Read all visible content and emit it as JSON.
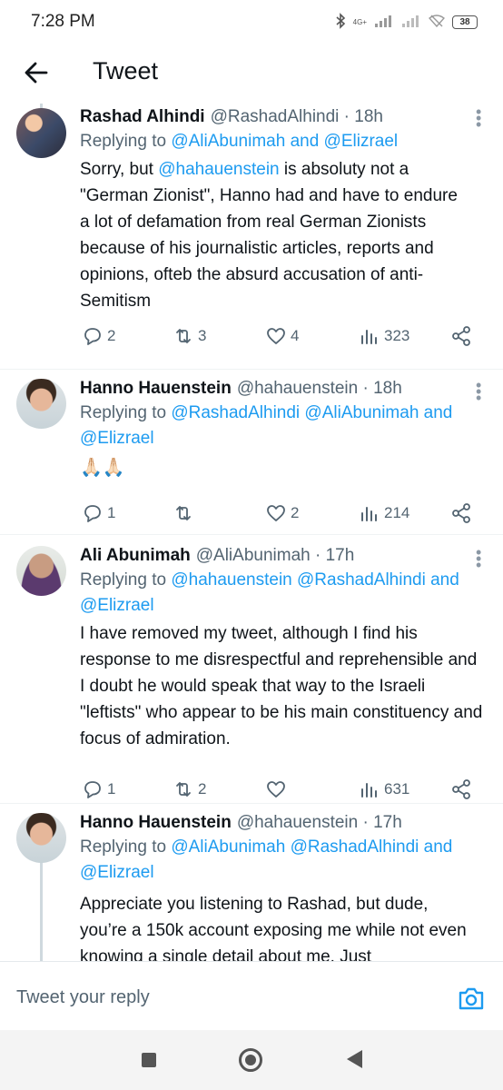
{
  "status_bar": {
    "time": "7:28 PM",
    "network": "4G+",
    "battery": "38"
  },
  "header": {
    "title": "Tweet"
  },
  "tweets": [
    {
      "name": "Rashad Alhindi",
      "meta": "@RashadAlhindi · 18h",
      "replying_prefix": "Replying to ",
      "replying_mentions": "@AliAbunimah and @Elizrael",
      "body_mention": "@hahauenstein",
      "body_pre": "Sorry, but ",
      "body_post": " is absoluty not a \"German Zionist\", Hanno had and have to endure a lot of defamation from real German Zionists because of his journalistic articles, reports and opinions, ofteb the absurd accusation of anti-Semitism",
      "replies": "2",
      "retweets": "3",
      "likes": "4",
      "views": "323"
    },
    {
      "name": "Hanno Hauenstein",
      "meta": "@hahauenstein · 18h",
      "replying_prefix": "Replying to ",
      "replying_mentions": "@RashadAlhindi @AliAbunimah and @Elizrael",
      "body": "🙏🏻🙏🏻",
      "replies": "1",
      "retweets": "",
      "likes": "2",
      "views": "214"
    },
    {
      "name": "Ali Abunimah",
      "meta": "@AliAbunimah · 17h",
      "replying_prefix": "Replying to ",
      "replying_mentions": "@hahauenstein @RashadAlhindi and @Elizrael",
      "body": "I have removed my tweet, although I find his response to me disrespectful and reprehensible and I doubt he would speak that way to the Israeli \"leftists\" who appear to be his main constituency and focus of admiration.",
      "replies": "1",
      "retweets": "2",
      "likes": "",
      "views": "631"
    },
    {
      "name": "Hanno Hauenstein",
      "meta": "@hahauenstein · 17h",
      "replying_prefix": "Replying to ",
      "replying_mentions": "@AliAbunimah @RashadAlhindi and @Elizrael",
      "body": "Appreciate you listening to Rashad, but dude, you’re a 150k account exposing me while not even knowing a single detail about me. Just"
    }
  ],
  "reply_bar": {
    "placeholder": "Tweet your reply"
  },
  "colors": {
    "accent": "#1d9bf0",
    "secondary_text": "#536471",
    "thread_line": "#cfd9de"
  }
}
